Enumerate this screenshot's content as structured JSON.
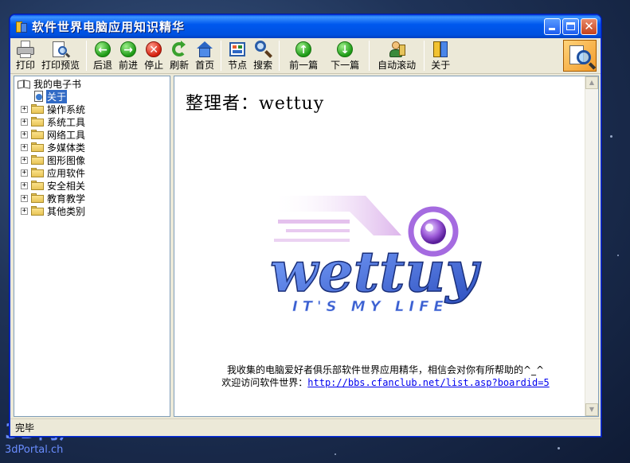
{
  "window": {
    "title": "软件世界电脑应用知识精华"
  },
  "toolbar": {
    "print": "打印",
    "print_preview": "打印预览",
    "back": "后退",
    "forward": "前进",
    "stop": "停止",
    "refresh": "刷新",
    "home": "首页",
    "node": "节点",
    "search": "搜索",
    "prev_article": "前一篇",
    "next_article": "下一篇",
    "auto_scroll": "自动滚动",
    "about": "关于"
  },
  "tree": {
    "root": "我的电子书",
    "about_item": "关于",
    "folders": [
      "操作系统",
      "系统工具",
      "网络工具",
      "多媒体类",
      "图形图像",
      "应用软件",
      "安全相关",
      "教育教学",
      "其他类别"
    ]
  },
  "content": {
    "heading": "整理者：wettuy",
    "logo_word": "wettuy",
    "logo_tagline": "IT'S MY LIFE",
    "line1": "我收集的电脑爱好者俱乐部软件世界应用精华，相信会对你有所帮助的^_^",
    "line2_prefix": "欢迎访问软件世界：",
    "link": "http://bbs.cfanclub.net/list.asp?boardid=5"
  },
  "status": {
    "text": "完毕"
  },
  "watermark": {
    "top": "3D门户",
    "bottom": "3dPortal.ch"
  },
  "colors": {
    "titlebar": "#0058ee",
    "selection": "#316ac5",
    "link": "#0000ee"
  }
}
